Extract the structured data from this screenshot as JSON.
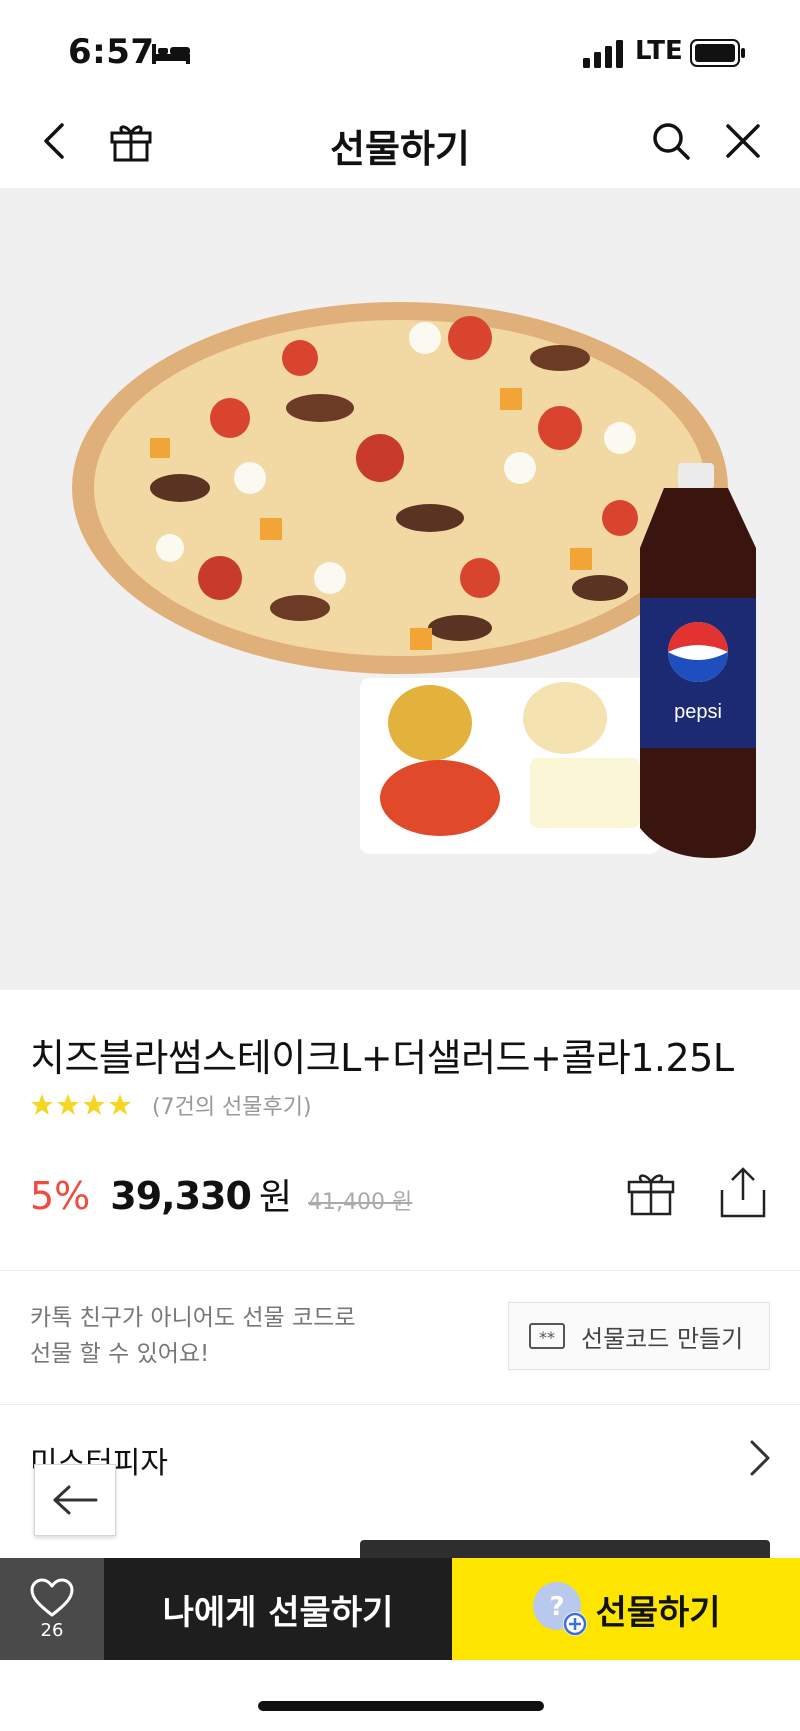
{
  "status_bar": {
    "time": "6:57",
    "network": "LTE",
    "icons": [
      "bed-icon",
      "signal-bars-icon",
      "battery-icon"
    ]
  },
  "header": {
    "title": "선물하기",
    "icons": [
      "chevron-left-icon",
      "gift-icon",
      "search-icon",
      "close-icon"
    ]
  },
  "product": {
    "image_brand_text": "pepsi",
    "name": "치즈블라썸스테이크L+더샐러드+콜라1.25L",
    "rating_stars": 4,
    "review_text": "(7건의 선물후기)",
    "discount": "5%",
    "price": "39,330",
    "price_unit": "원",
    "original_price": "41,400 원"
  },
  "gift_code": {
    "note_line1": "카톡 친구가 아니어도 선물 코드로",
    "note_line2": "선물 할 수 있어요!",
    "button_label": "선물코드 만들기",
    "button_icon_text": "**"
  },
  "brand": {
    "name": "미스터피자"
  },
  "bottom_bar": {
    "like_count": "26",
    "self_gift_label": "나에게 선물하기",
    "gift_label": "선물하기"
  },
  "colors": {
    "accent_yellow": "#fee500",
    "discount_red": "#f04b3e",
    "dark_button": "#1e1e1e",
    "like_button": "#4a4a4a"
  }
}
